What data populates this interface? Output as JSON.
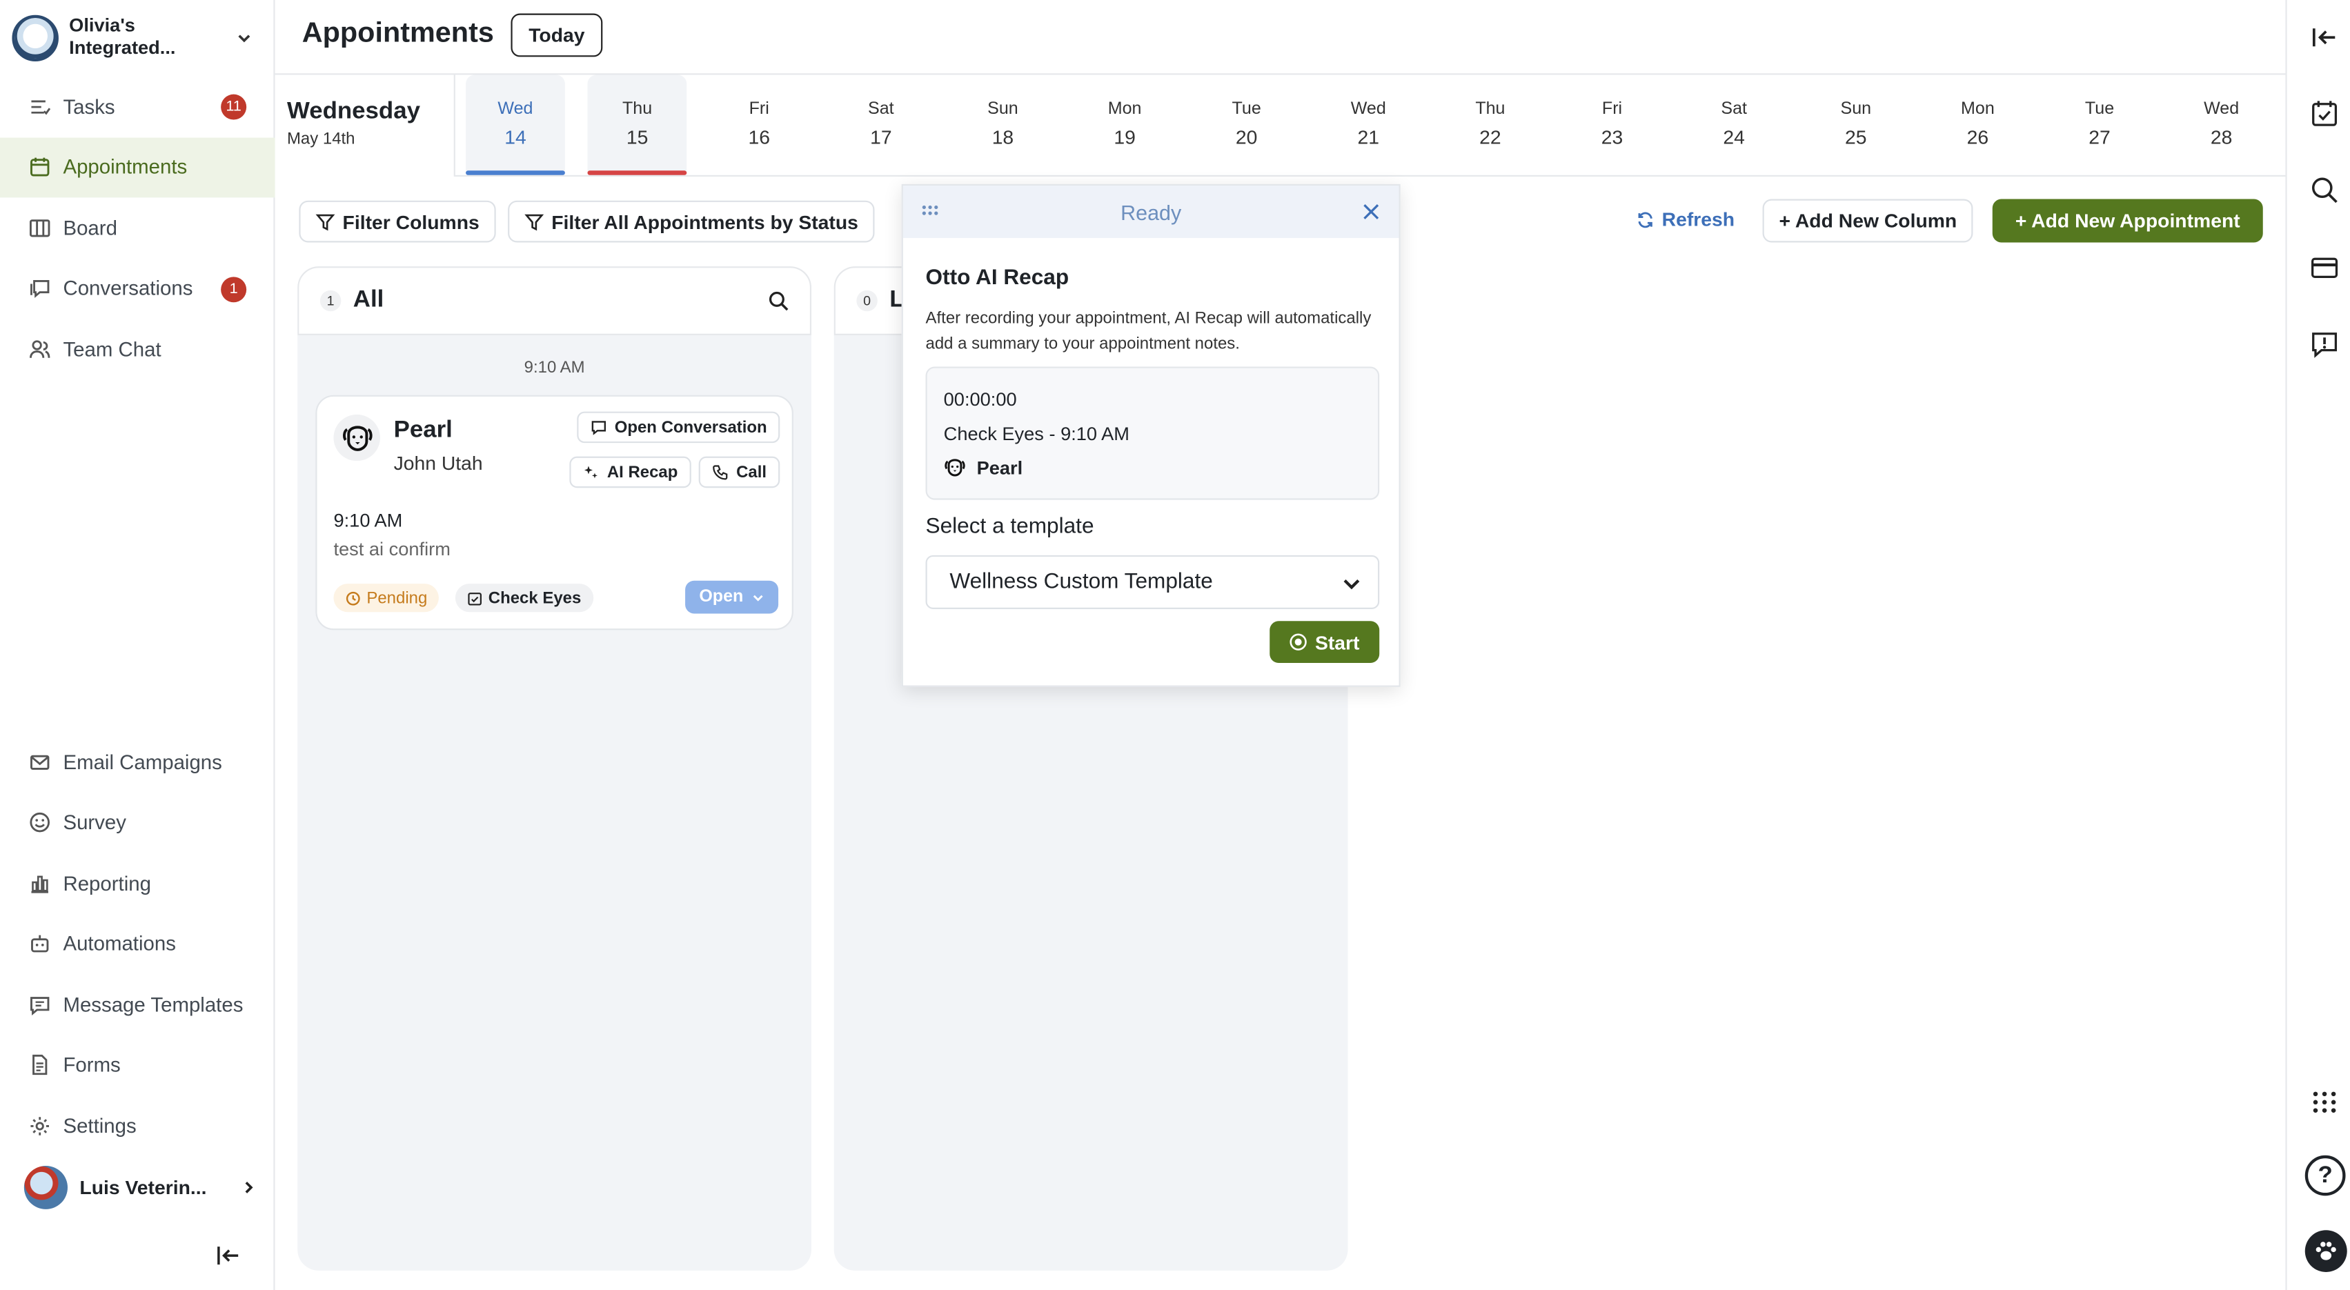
{
  "org": {
    "name": "Olivia's Integrated..."
  },
  "nav_top": [
    {
      "label": "Tasks",
      "badge": "11",
      "icon": "tasks-icon"
    },
    {
      "label": "Appointments",
      "badge": "",
      "icon": "calendar-icon"
    },
    {
      "label": "Board",
      "badge": "",
      "icon": "board-icon"
    },
    {
      "label": "Conversations",
      "badge": "1",
      "icon": "chat-icon"
    },
    {
      "label": "Team Chat",
      "badge": "",
      "icon": "team-icon"
    }
  ],
  "nav_bottom": [
    {
      "label": "Email Campaigns",
      "icon": "email-icon"
    },
    {
      "label": "Survey",
      "icon": "smile-icon"
    },
    {
      "label": "Reporting",
      "icon": "chart-icon"
    },
    {
      "label": "Automations",
      "icon": "robot-icon"
    },
    {
      "label": "Message Templates",
      "icon": "message-icon"
    },
    {
      "label": "Forms",
      "icon": "document-icon"
    },
    {
      "label": "Settings",
      "icon": "gear-icon"
    }
  ],
  "user": {
    "name": "Luis Veterin..."
  },
  "header": {
    "title": "Appointments",
    "today_label": "Today"
  },
  "selected_day": {
    "weekday": "Wednesday",
    "date": "May 14th"
  },
  "days": [
    {
      "dow": "Wed",
      "num": "14"
    },
    {
      "dow": "Thu",
      "num": "15"
    },
    {
      "dow": "Fri",
      "num": "16"
    },
    {
      "dow": "Sat",
      "num": "17"
    },
    {
      "dow": "Sun",
      "num": "18"
    },
    {
      "dow": "Mon",
      "num": "19"
    },
    {
      "dow": "Tue",
      "num": "20"
    },
    {
      "dow": "Wed",
      "num": "21"
    },
    {
      "dow": "Thu",
      "num": "22"
    },
    {
      "dow": "Fri",
      "num": "23"
    },
    {
      "dow": "Sat",
      "num": "24"
    },
    {
      "dow": "Sun",
      "num": "25"
    },
    {
      "dow": "Mon",
      "num": "26"
    },
    {
      "dow": "Tue",
      "num": "27"
    },
    {
      "dow": "Wed",
      "num": "28"
    }
  ],
  "toolbar": {
    "filter_columns": "Filter Columns",
    "filter_status": "Filter All Appointments by Status",
    "refresh": "Refresh",
    "add_column": "+ Add New Column",
    "add_appointment": "+ Add New Appointment"
  },
  "columns": [
    {
      "count": "1",
      "title": "All",
      "time_label": "9:10 AM"
    },
    {
      "count": "0",
      "title": "L"
    }
  ],
  "card": {
    "pet": "Pearl",
    "owner": "John Utah",
    "open_conversation": "Open Conversation",
    "ai_recap": "AI Recap",
    "call": "Call",
    "time": "9:10 AM",
    "note": "test ai confirm",
    "status": "Pending",
    "type": "Check Eyes",
    "open": "Open"
  },
  "popup": {
    "status": "Ready",
    "title": "Otto AI Recap",
    "description": "After recording your appointment, AI Recap will automatically add a summary to your appointment notes.",
    "timer": "00:00:00",
    "appointment": "Check Eyes - 9:10 AM",
    "pet": "Pearl",
    "template_label": "Select a template",
    "template_value": "Wellness Custom Template",
    "start": "Start"
  },
  "colors": {
    "accent_green": "#55781f",
    "accent_blue": "#3d6fb8",
    "badge_red": "#c0392b"
  }
}
